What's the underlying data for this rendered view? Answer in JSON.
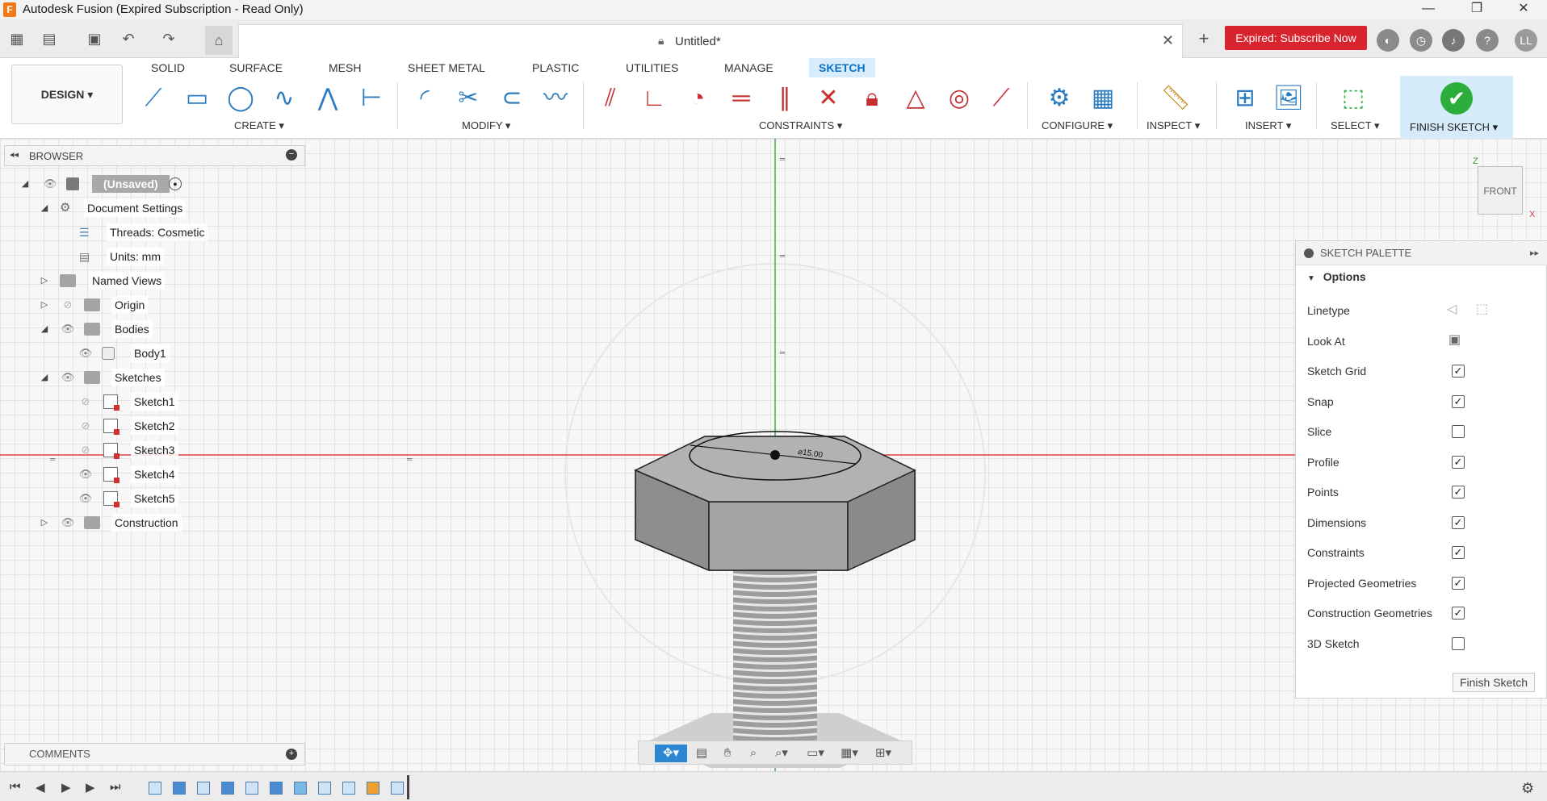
{
  "window": {
    "title": "Autodesk Fusion (Expired Subscription - Read Only)"
  },
  "document": {
    "tab_title": "Untitled*"
  },
  "header": {
    "subscribe_label": "Expired: Subscribe Now",
    "user_initials": "LL"
  },
  "ribbon": {
    "workspace": "DESIGN ▾",
    "tabs": [
      "SOLID",
      "SURFACE",
      "MESH",
      "SHEET METAL",
      "PLASTIC",
      "UTILITIES",
      "MANAGE",
      "SKETCH"
    ],
    "groups": [
      "CREATE ▾",
      "MODIFY ▾",
      "CONSTRAINTS ▾",
      "CONFIGURE ▾",
      "INSPECT ▾",
      "INSERT ▾",
      "SELECT ▾",
      "FINISH SKETCH ▾"
    ]
  },
  "browser": {
    "title": "BROWSER",
    "items": [
      {
        "label": "(Unsaved)"
      },
      {
        "label": "Document Settings"
      },
      {
        "label": "Threads: Cosmetic"
      },
      {
        "label": "Units: mm"
      },
      {
        "label": "Named Views"
      },
      {
        "label": "Origin"
      },
      {
        "label": "Bodies"
      },
      {
        "label": "Body1"
      },
      {
        "label": "Sketches"
      },
      {
        "label": "Sketch1"
      },
      {
        "label": "Sketch2"
      },
      {
        "label": "Sketch3"
      },
      {
        "label": "Sketch4"
      },
      {
        "label": "Sketch5"
      },
      {
        "label": "Construction"
      }
    ]
  },
  "canvas": {
    "dimension_label": "⌀15.00",
    "viewcube_label": "FRONT",
    "axis_z": "Z",
    "axis_x": "X"
  },
  "palette": {
    "title": "SKETCH PALETTE",
    "section": "Options",
    "options": [
      {
        "label": "Linetype"
      },
      {
        "label": "Look At"
      },
      {
        "label": "Sketch Grid",
        "checked": "✓"
      },
      {
        "label": "Snap",
        "checked": "✓"
      },
      {
        "label": "Slice",
        "checked": ""
      },
      {
        "label": "Profile",
        "checked": "✓"
      },
      {
        "label": "Points",
        "checked": "✓"
      },
      {
        "label": "Dimensions",
        "checked": "✓"
      },
      {
        "label": "Constraints",
        "checked": "✓"
      },
      {
        "label": "Projected Geometries",
        "checked": "✓"
      },
      {
        "label": "Construction Geometries",
        "checked": "✓"
      },
      {
        "label": "3D Sketch",
        "checked": ""
      }
    ],
    "finish_label": "Finish Sketch"
  },
  "comments": {
    "title": "COMMENTS"
  },
  "colors": {
    "accent": "#0a72c9",
    "subscribe": "#d9232d",
    "finish_green": "#2dae3c",
    "axis_red": "#e04040",
    "axis_green": "#3cb043"
  }
}
